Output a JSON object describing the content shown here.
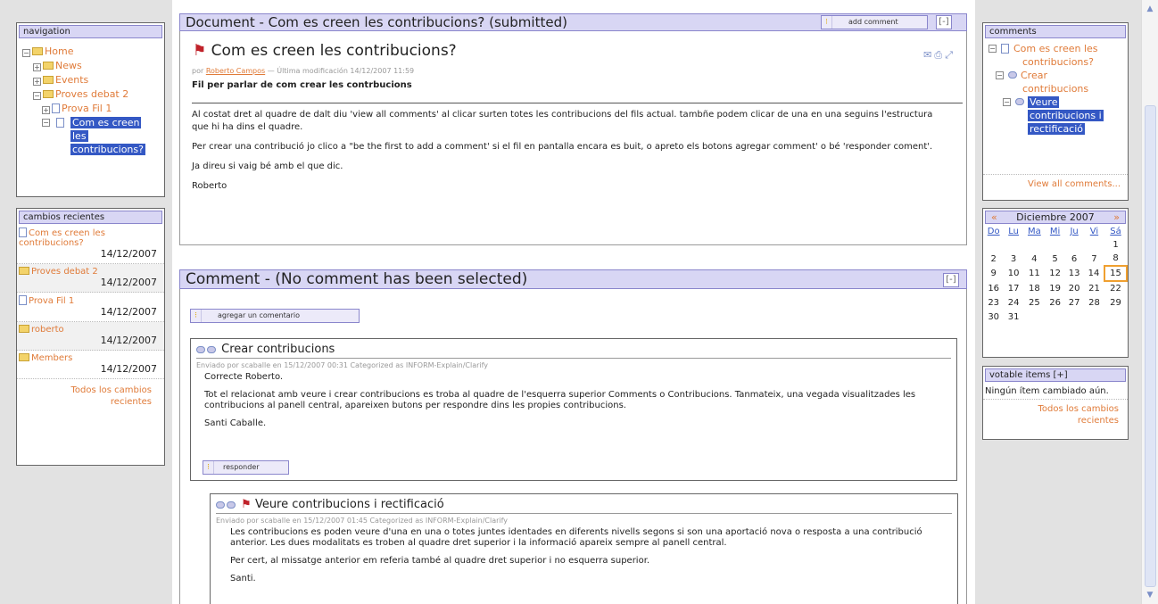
{
  "navigation": {
    "title": "navigation",
    "items": [
      {
        "label": "Home"
      },
      {
        "label": "News"
      },
      {
        "label": "Events"
      },
      {
        "label": "Proves debat 2"
      },
      {
        "label": "Prova Fil 1"
      },
      {
        "label_lines": [
          "Com es creen",
          "les",
          "contribucions?"
        ]
      }
    ]
  },
  "recent": {
    "title": "cambios recientes",
    "items": [
      {
        "label_lines": [
          "Com es creen les",
          "contribucions?"
        ],
        "date": "14/12/2007"
      },
      {
        "label": "Proves debat 2",
        "date": "14/12/2007"
      },
      {
        "label": "Prova Fil 1",
        "date": "14/12/2007"
      },
      {
        "label": "roberto",
        "date": "14/12/2007"
      },
      {
        "label": "Members",
        "date": "14/12/2007"
      }
    ],
    "all_link_lines": [
      "Todos los cambios",
      "recientes"
    ]
  },
  "document": {
    "panel_title": "Document - Com es creen les contribucions? (submitted)",
    "add_comment": "add comment",
    "collapse": "[-]",
    "heading": "Com es creen les contribucions?",
    "meta_prefix": "por",
    "author": "Roberto Campos",
    "meta_suffix": "— Última modificación 14/12/2007 11:59",
    "description": "Fil per parlar de com crear les contrbucions",
    "paragraphs": [
      "Al costat dret al quadre de dalt diu 'view all comments' al clicar surten totes les contribucions del fils actual. tambñe podem clicar de una en una seguins l'estructura que hi ha dins el quadre.",
      "Per crear una contribució jo clico a \"be the first to add a comment' si el fil en pantalla encara es buit, o apreto els botons agregar comment' o bé 'responder coment'.",
      "Ja direu si vaig bé amb el que dic.",
      "Roberto"
    ]
  },
  "comment_panel": {
    "title": "Comment - (No comment has been selected)",
    "collapse": "[-]",
    "add_button": "agregar un comentario",
    "comments": [
      {
        "title": "Crear contribucions",
        "meta": "Enviado por scaballe en 15/12/2007 00:31 Categorized as INFORM-Explain/Clarify",
        "paragraphs": [
          "Correcte Roberto.",
          "Tot el relacionat amb veure i crear contribucions es troba al quadre de l'esquerra superior Comments o Contribucions. Tanmateix, una vegada visualitzades les contribucions al panell central, apareixen butons per respondre dins les propies contribucions.",
          "Santi Caballe."
        ],
        "reply": "responder"
      },
      {
        "title": "Veure contribucions i rectificació",
        "meta": "Enviado por scaballe en 15/12/2007 01:45 Categorized as INFORM-Explain/Clarify",
        "paragraphs": [
          "Les contribucions es poden veure d'una en una o totes juntes identades en diferents nivells segons si son una aportació nova o resposta a una contribució anterior. Les dues modalitats es troben al quadre dret superior i la informació apareix sempre al panell central.",
          "Per cert, al missatge anterior em referia també al quadre dret superior i no esquerra superior.",
          "Santi."
        ]
      }
    ]
  },
  "comments_box": {
    "title": "comments",
    "tree": [
      {
        "label_lines": [
          "Com es creen les",
          "contribucions?"
        ]
      },
      {
        "label_lines": [
          "Crear",
          "contribucions"
        ]
      },
      {
        "label_lines": [
          "Veure",
          "contribucions i",
          "rectificació"
        ]
      }
    ],
    "view_all": "View all comments..."
  },
  "calendar": {
    "month": "Diciembre 2007",
    "prev": "«",
    "next": "»",
    "days": [
      "Do",
      "Lu",
      "Ma",
      "Mi",
      "Ju",
      "Vi",
      "Sá"
    ],
    "weeks": [
      [
        "",
        "",
        "",
        "",
        "",
        "",
        "1"
      ],
      [
        "2",
        "3",
        "4",
        "5",
        "6",
        "7",
        "8"
      ],
      [
        "9",
        "10",
        "11",
        "12",
        "13",
        "14",
        "15"
      ],
      [
        "16",
        "17",
        "18",
        "19",
        "20",
        "21",
        "22"
      ],
      [
        "23",
        "24",
        "25",
        "26",
        "27",
        "28",
        "29"
      ],
      [
        "30",
        "31",
        "",
        "",
        "",
        "",
        ""
      ]
    ],
    "today": "15"
  },
  "votable": {
    "title": "votable items [+]",
    "empty": "Ningún ítem cambiado aún.",
    "all_link_lines": [
      "Todos los cambios",
      "recientes"
    ]
  }
}
